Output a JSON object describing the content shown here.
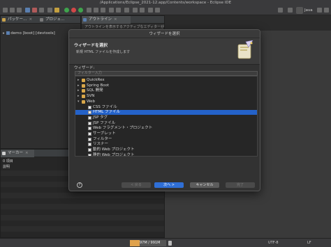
{
  "window": {
    "title": "/Applications/Eclipse_2021-12.app/Contents/workspace - Eclipse IDE"
  },
  "toolbar": {
    "perspective_java": "Java"
  },
  "left_panel": {
    "tab_package": "パッケー…",
    "tab_project": "プロジェ…",
    "project_item": "demo [boot] [devtools]"
  },
  "outline_panel": {
    "tab_outline": "アウトライン",
    "message": "アウトラインを表示するアクティブなエディターが"
  },
  "markers_panel": {
    "tab_markers": "マーカー",
    "items_header": "0 項目",
    "col_description": "説明"
  },
  "dialog": {
    "title": "ウィザードを選択",
    "heading": "ウィザードを選択",
    "description": "新規 HTML ファイルを作成します",
    "wizards_label": "ウィザード:",
    "filter_placeholder": "フィルター入力",
    "tree": [
      {
        "label": "QuickRex",
        "kind": "folder",
        "level": 0,
        "expanded": false,
        "selected": false
      },
      {
        "label": "Spring Boot",
        "kind": "folder",
        "level": 0,
        "expanded": false,
        "selected": false
      },
      {
        "label": "SQL 開発",
        "kind": "folder",
        "level": 0,
        "expanded": false,
        "selected": false
      },
      {
        "label": "SVN",
        "kind": "folder",
        "level": 0,
        "expanded": false,
        "selected": false
      },
      {
        "label": "Web",
        "kind": "folder",
        "level": 0,
        "expanded": true,
        "selected": false
      },
      {
        "label": "CSS ファイル",
        "kind": "doc",
        "level": 1,
        "expanded": false,
        "selected": false
      },
      {
        "label": "HTML ファイル",
        "kind": "doc",
        "level": 1,
        "expanded": false,
        "selected": true
      },
      {
        "label": "JSP タグ",
        "kind": "doc",
        "level": 1,
        "expanded": false,
        "selected": false
      },
      {
        "label": "JSP ファイル",
        "kind": "doc",
        "level": 1,
        "expanded": false,
        "selected": false
      },
      {
        "label": "Web フラグメント・プロジェクト",
        "kind": "doc",
        "level": 1,
        "expanded": false,
        "selected": false
      },
      {
        "label": "サーブレット",
        "kind": "doc",
        "level": 1,
        "expanded": false,
        "selected": false
      },
      {
        "label": "フィルター",
        "kind": "doc",
        "level": 1,
        "expanded": false,
        "selected": false
      },
      {
        "label": "リスナー",
        "kind": "doc",
        "level": 1,
        "expanded": false,
        "selected": false
      },
      {
        "label": "動的 Web プロジェクト",
        "kind": "doc",
        "level": 1,
        "expanded": false,
        "selected": false
      },
      {
        "label": "静的 Web プロジェクト",
        "kind": "doc",
        "level": 1,
        "expanded": false,
        "selected": false
      }
    ],
    "buttons": {
      "help": "?",
      "back": "< 戻る",
      "next": "次へ >",
      "cancel": "キャンセル",
      "finish": "完了"
    }
  },
  "status": {
    "heap": "97M / 991M",
    "encoding": "UTF-8",
    "line_ending": "LF"
  },
  "colors": {
    "accent": "#2f6fd6",
    "selection": "#2462c9",
    "folder": "#d8a74a"
  }
}
